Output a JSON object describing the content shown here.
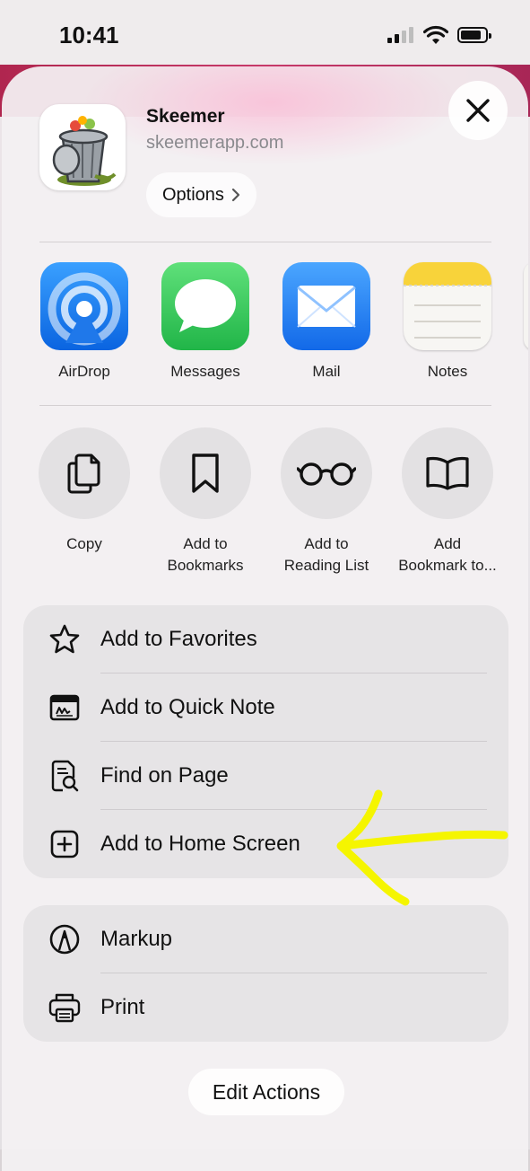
{
  "status": {
    "time": "10:41"
  },
  "site": {
    "title": "Skeemer",
    "url": "skeemerapp.com",
    "options_label": "Options"
  },
  "share_apps": [
    {
      "label": "AirDrop",
      "icon": "airdrop-icon"
    },
    {
      "label": "Messages",
      "icon": "messages-icon"
    },
    {
      "label": "Mail",
      "icon": "mail-icon"
    },
    {
      "label": "Notes",
      "icon": "notes-icon"
    }
  ],
  "quick_actions": [
    {
      "label": "Copy",
      "icon": "copy-icon"
    },
    {
      "label": "Add to\nBookmarks",
      "icon": "bookmark-icon"
    },
    {
      "label": "Add to\nReading List",
      "icon": "glasses-icon"
    },
    {
      "label": "Add\nBookmark to...",
      "icon": "book-icon"
    }
  ],
  "menu_group_1": [
    {
      "label": "Add to Favorites",
      "icon": "star-icon"
    },
    {
      "label": "Add to Quick Note",
      "icon": "quick-note-icon"
    },
    {
      "label": "Find on Page",
      "icon": "find-on-page-icon"
    },
    {
      "label": "Add to Home Screen",
      "icon": "plus-square-icon"
    }
  ],
  "menu_group_2": [
    {
      "label": "Markup",
      "icon": "markup-icon"
    },
    {
      "label": "Print",
      "icon": "printer-icon"
    }
  ],
  "edit_actions_label": "Edit Actions",
  "colors": {
    "annotation_arrow": "#f5f500",
    "airdrop": "#1a7cf0",
    "messages": "#35c759",
    "mail": "#1f7ef2",
    "notes_header": "#f8d33a"
  }
}
